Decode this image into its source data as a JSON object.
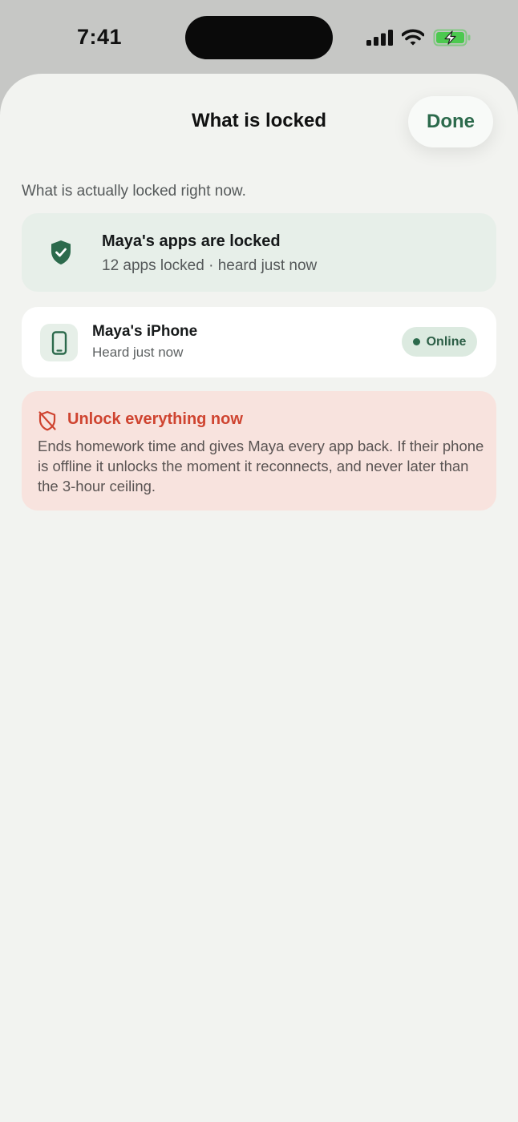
{
  "status_bar": {
    "time": "7:41",
    "icons": [
      "cellular-signal-icon",
      "wifi-icon",
      "battery-charging-icon"
    ]
  },
  "header": {
    "title": "What is locked",
    "done_label": "Done"
  },
  "intro": "What is actually locked right now.",
  "lock_status": {
    "icon": "shield-check-icon",
    "title": "Maya's apps are locked",
    "subtitle": "12 apps locked · heard just now"
  },
  "device": {
    "icon": "phone-icon",
    "name": "Maya's iPhone",
    "subtitle": "Heard just now",
    "badge": "Online"
  },
  "unlock": {
    "icon": "shield-off-icon",
    "title": "Unlock everything now",
    "description": "Ends homework time and gives Maya every app back. If their phone is offline it unlocks the moment it reconnects, and never later than the 3-hour ceiling."
  },
  "colors": {
    "accent_green": "#2c6a4c",
    "danger_red": "#cf4430",
    "sheet_background": "#f2f3f0",
    "status_card_background": "#e7efe9",
    "unlock_card_background": "#f8e3de",
    "battery_green": "#4cc94f"
  }
}
